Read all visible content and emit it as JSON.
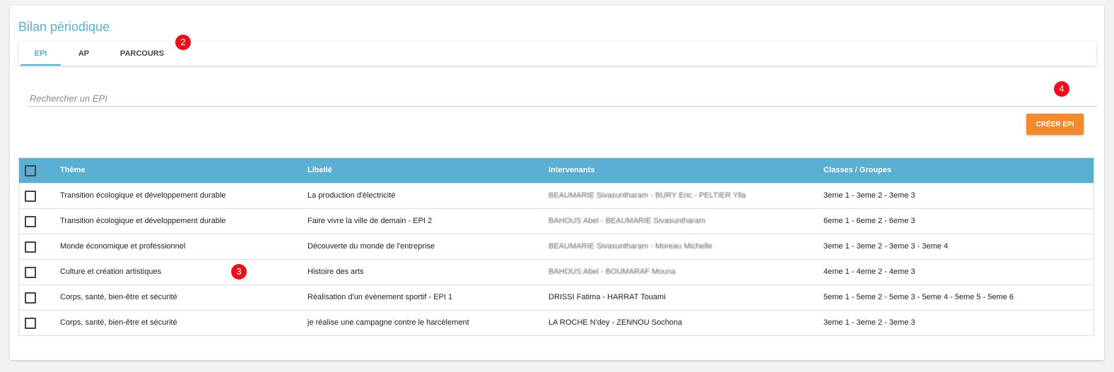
{
  "page": {
    "title": "Bilan périodique"
  },
  "tabs": [
    {
      "label": "EPI",
      "active": true
    },
    {
      "label": "AP",
      "active": false
    },
    {
      "label": "PARCOURS",
      "active": false
    }
  ],
  "badges": [
    "2",
    "3",
    "4"
  ],
  "search": {
    "placeholder": "Rechercher un EPI",
    "value": ""
  },
  "actions": {
    "create_label": "CRÉER EPI"
  },
  "table": {
    "headers": {
      "theme": "Thème",
      "libelle": "Libellé",
      "intervenants": "Intervenants",
      "classes": "Classes / Groupes"
    },
    "rows": [
      {
        "theme": "Transition écologique et développement durable",
        "libelle": "La production d'électricité",
        "intervenants": "BEAUMARIE Sivasuntharam - BURY Eric - PELTIER Ylla",
        "classes": "3eme 1 - 3eme 2 - 3eme 3"
      },
      {
        "theme": "Transition écologique et développement durable",
        "libelle": "Faire vivre la ville de demain - EPI 2",
        "intervenants": "BAHOUS Abel - BEAUMARIE Sivasuntharam",
        "classes": "6eme 1 - 6eme 2 - 6eme 3"
      },
      {
        "theme": "Monde économique et professionnel",
        "libelle": "Découverte du monde de l'entreprise",
        "intervenants": "BEAUMARIE Sivasuntharam - Moreau Michelle",
        "classes": "3eme 1 - 3eme 2 - 3eme 3 - 3eme 4"
      },
      {
        "theme": "Culture et création artistiques",
        "libelle": "Histoire des arts",
        "intervenants": "BAHOUS Abel - BOUMARAF Mouna",
        "classes": "4eme 1 - 4eme 2 - 4eme 3"
      },
      {
        "theme": "Corps, santé, bien-être et sécurité",
        "libelle": "Réalisation d'un évènement sportif - EPI 1",
        "intervenants": "DRISSI Fatima - HARRAT Touami",
        "classes": "5eme 1 - 5eme 2 - 5eme 3 - 5eme 4 - 5eme 5 - 5eme 6"
      },
      {
        "theme": "Corps, santé, bien-être et sécurité",
        "libelle": "je réalise une campagne contre le harcèlement",
        "intervenants": "LA ROCHE N'dey - ZENNOU Sochona",
        "classes": "3eme 1 - 3eme 2 - 3eme 3"
      }
    ]
  },
  "colors": {
    "accent": "#5bafd2",
    "button": "#f28a2e",
    "badge": "#e8101a"
  }
}
